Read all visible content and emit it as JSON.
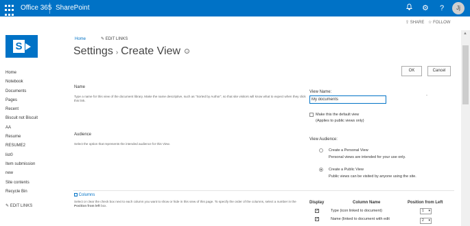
{
  "suite_bar": {
    "title": "Office 365",
    "app": "SharePoint",
    "bell_glyph": "🔔",
    "gear_glyph": "⚙",
    "help_glyph": "?",
    "avatar_initials": "Jj"
  },
  "action_bar": {
    "share": "SHARE",
    "follow": "FOLLOW"
  },
  "header": {
    "home_link": "Home",
    "edit_links": "EDIT LINKS",
    "title_settings": "Settings",
    "title_page": "Create View"
  },
  "nav": {
    "items": [
      "Home",
      "Notebook",
      "Documents",
      "Pages",
      "Recent",
      "Biscuit not Biscuit",
      "AA",
      "Resume",
      "RESUME2",
      "list0",
      "Item submission",
      "new",
      "Site contents",
      "Recycle Bin"
    ],
    "edit_links": "EDIT LINKS"
  },
  "buttons": {
    "ok": "OK",
    "cancel": "Cancel"
  },
  "name_section": {
    "title": "Name",
    "description": "Type a name for this view of the document library. Make the name descriptive, such as \"Sorted by Author\", so that site visitors will know what to expect when they click this link.",
    "view_name_label": "View Name:",
    "view_name_value": "My documents",
    "default_view_label": "Make this the default view",
    "default_view_note": "(Applies to public views only)"
  },
  "audience_section": {
    "title": "Audience",
    "description": "Select the option that represents the intended audience for this View.",
    "view_audience_label": "View Audience:",
    "personal_label": "Create a Personal View",
    "personal_desc": "Personal views are intended for your use only.",
    "public_label": "Create a Public View",
    "public_desc": "Public views can be visited by anyone using the site."
  },
  "columns_section": {
    "title": "Columns",
    "description": "Select or clear the check box next to each column you want to show or hide in this view of this page. To specify the order of the columns, select a number in the",
    "description_bold": "Position from left",
    "description_end": "box.",
    "header_display": "Display",
    "header_column_name": "Column Name",
    "header_position": "Position from Left",
    "rows": [
      {
        "name": "Type (icon linked to document)",
        "position": "1",
        "checked": true
      },
      {
        "name": "Name (linked to document with edit",
        "position": "2",
        "checked": true
      }
    ]
  }
}
